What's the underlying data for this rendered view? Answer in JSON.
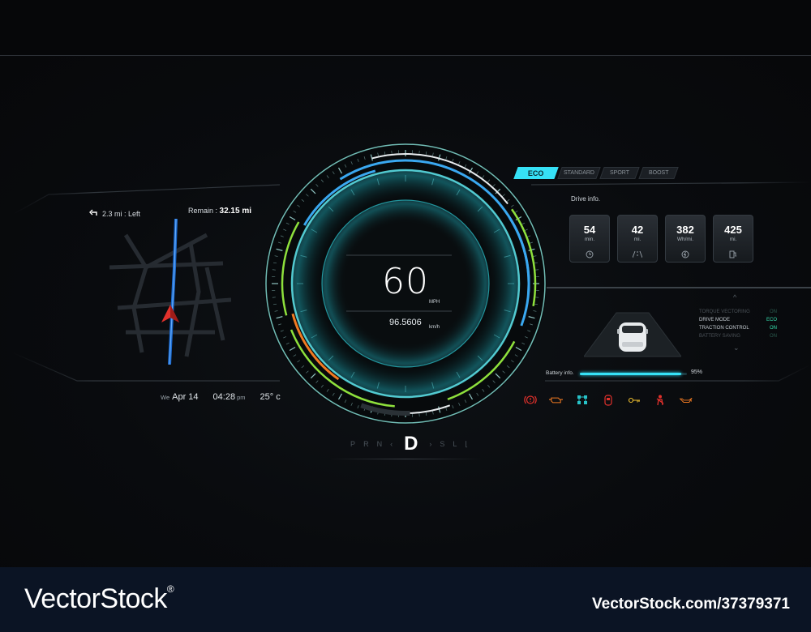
{
  "navigation": {
    "turn_text": "2.3 mi : Left",
    "remain_label": "Remain :",
    "remain_value": "32.15 mi"
  },
  "info_bar": {
    "day": "We",
    "date": "Apr 14",
    "time": "04:28",
    "time_suffix": "pm",
    "temperature": "25° c"
  },
  "speedometer": {
    "speed": "60",
    "speed_unit": "MPH",
    "speed_kmh": "96.5606",
    "kmh_unit": "km/h"
  },
  "gear": {
    "left": [
      "P",
      "R",
      "N"
    ],
    "active": "D",
    "right": [
      "S",
      "L"
    ]
  },
  "modes": [
    {
      "label": "ECO",
      "active": true
    },
    {
      "label": "STANDARD",
      "active": false
    },
    {
      "label": "SPORT",
      "active": false
    },
    {
      "label": "BOOST",
      "active": false
    }
  ],
  "drive_info": {
    "title": "Drive info.",
    "cards": [
      {
        "value": "54",
        "unit": "min.",
        "icon": "clock-icon"
      },
      {
        "value": "42",
        "unit": "mi.",
        "icon": "road-icon"
      },
      {
        "value": "382",
        "unit": "Wh/mi.",
        "icon": "energy-icon"
      },
      {
        "value": "425",
        "unit": "mi.",
        "icon": "charger-icon"
      }
    ]
  },
  "status_list": [
    {
      "label": "TORQUE VECTORING",
      "value": "ON",
      "dim": true
    },
    {
      "label": "DRIVE MODE",
      "value": "ECO",
      "dim": false
    },
    {
      "label": "TRACTION CONTROL",
      "value": "ON",
      "dim": false
    },
    {
      "label": "BATTERY SAVING",
      "value": "ON",
      "dim": true
    }
  ],
  "battery": {
    "label": "Battery info.",
    "percent_text": "95%",
    "level": 0.95
  },
  "warning_icons": [
    "brake-warning-icon",
    "engine-check-icon",
    "tire-pressure-icon",
    "door-open-icon",
    "key-icon",
    "seatbelt-icon",
    "oil-pressure-icon"
  ],
  "colors": {
    "accent": "#36e1f6",
    "gauge_blue": "#3aa8f0",
    "gauge_green": "#8ee03c",
    "gauge_orange": "#f07a22",
    "warning_red": "#e2312c"
  },
  "watermark": {
    "brand": "VectorStock",
    "registered": "®",
    "stock_id": "VectorStock.com/37379371"
  }
}
